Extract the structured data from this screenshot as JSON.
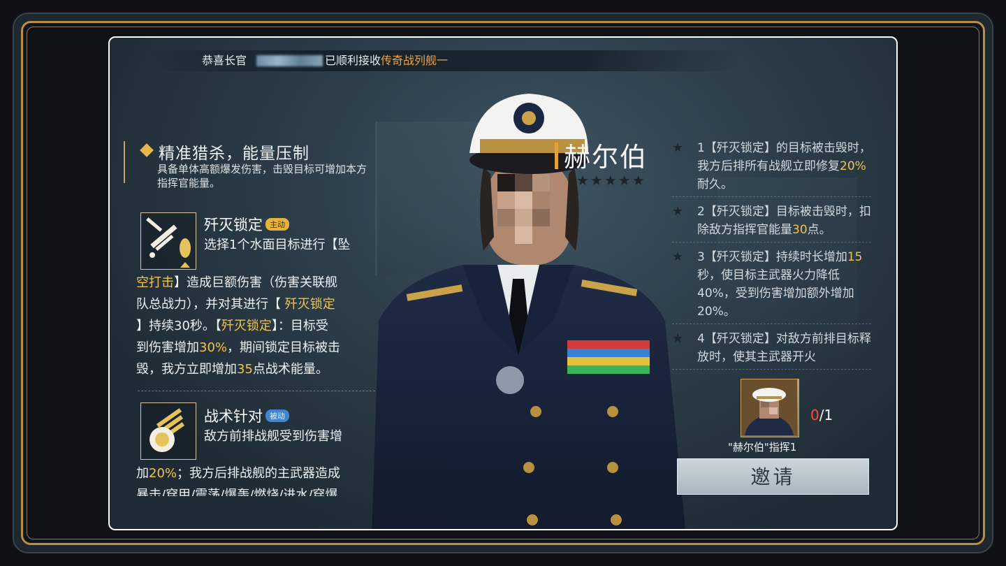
{
  "notice": {
    "prefix": "恭喜长官",
    "middle": "已顺利接收",
    "highlight": "传奇战列舰",
    "suffix": "一"
  },
  "left": {
    "section_title": "精准猎杀，能量压制",
    "section_desc": "具备单体高额爆发伤害，击毁目标可增加本方指挥官能量。",
    "skill1": {
      "name": "歼灭锁定",
      "tag": "主动",
      "line1": "选择1个水面目标进行【坠",
      "line2": "空打击】造成巨额伤害（伤害关联舰",
      "line3": "队总战力），并对其进行【",
      "line3_hl": "歼灭锁定",
      "line4_a": "】持续30秒。【",
      "line4_hl": "歼灭锁定",
      "line4_b": "】：目标受",
      "line5_a": "到伤害增加",
      "line5_hl": "30%",
      "line5_b": "，期间锁定目标被击",
      "line6_a": "毁，我方立即增加",
      "line6_hl": "35",
      "line6_b": "点战术能量。"
    },
    "skill2": {
      "name": "战术针对",
      "tag": "被动",
      "line1": "敌方前排战舰受到伤害增",
      "line2_a": "加",
      "line2_hl": "20%",
      "line2_b": "；我方后排战舰的主武器造成",
      "line3": "暴击/穿甲/震荡/爆轰/燃烧/进水/穿爆"
    }
  },
  "officer": {
    "name": "赫尔伯",
    "stars": "★★★★★"
  },
  "talents": [
    {
      "star": "★",
      "num": "1",
      "a": "【歼灭锁定】的目标被击毁时，我方后排所有战舰立即修复",
      "hl": "20%",
      "b": "耐久。"
    },
    {
      "star": "★",
      "num": "2",
      "a": "【歼灭锁定】目标被击毁时，扣除敌方指挥官能量",
      "hl": "30",
      "b": "点。"
    },
    {
      "star": "★",
      "num": "3",
      "a": "【歼灭锁定】持续时长增加",
      "hl": "15",
      "b": "秒，使目标主武器火力降低40%，受到伤害增加额外增加20%。"
    },
    {
      "star": "★",
      "num": "4",
      "a": "【歼灭锁定】对敌方前排目标释放时，使其主武器开火",
      "hl": "",
      "b": ""
    }
  ],
  "invite": {
    "count_current": "0",
    "count_total": "/1",
    "caption": "\"赫尔伯\"指挥1",
    "button_label": "邀请"
  },
  "colors": {
    "accent_gold": "#f2c34d",
    "notice_orange": "#f3a13a",
    "frame_gold": "#b98e4a"
  }
}
